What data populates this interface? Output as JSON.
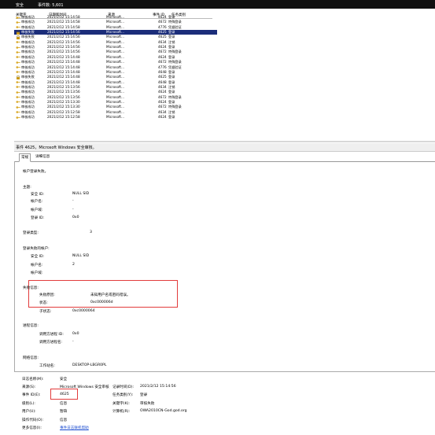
{
  "topbar": {
    "title": "安全",
    "count": "事件数: 5,601"
  },
  "columns": [
    "关键字",
    "日期和时间",
    "来源",
    "事件 ID",
    "任务类别"
  ],
  "events": [
    {
      "k": "审核成功",
      "d": "2021/2/12 15:14:58",
      "s": "Microsoft...",
      "id": "4624",
      "c": "登录",
      "lock": false,
      "sel": false
    },
    {
      "k": "审核成功",
      "d": "2021/2/12 15:14:58",
      "s": "Microsoft...",
      "id": "4672",
      "c": "特殊登录",
      "lock": false,
      "sel": false
    },
    {
      "k": "审核成功",
      "d": "2021/2/12 15:14:58",
      "s": "Microsoft...",
      "id": "4776",
      "c": "凭据验证",
      "lock": false,
      "sel": false
    },
    {
      "k": "审核失败",
      "d": "2021/2/12 15:14:56",
      "s": "Microsoft...",
      "id": "4625",
      "c": "登录",
      "lock": true,
      "sel": true
    },
    {
      "k": "审核失败",
      "d": "2021/2/12 15:14:56",
      "s": "Microsoft...",
      "id": "4625",
      "c": "登录",
      "lock": true,
      "sel": false
    },
    {
      "k": "审核成功",
      "d": "2021/2/12 15:14:56",
      "s": "Microsoft...",
      "id": "4634",
      "c": "注销",
      "lock": false,
      "sel": false
    },
    {
      "k": "审核成功",
      "d": "2021/2/12 15:14:56",
      "s": "Microsoft...",
      "id": "4624",
      "c": "登录",
      "lock": false,
      "sel": false
    },
    {
      "k": "审核成功",
      "d": "2021/2/12 15:14:56",
      "s": "Microsoft...",
      "id": "4672",
      "c": "特殊登录",
      "lock": false,
      "sel": false
    },
    {
      "k": "审核成功",
      "d": "2021/2/12 15:14:48",
      "s": "Microsoft...",
      "id": "4624",
      "c": "登录",
      "lock": false,
      "sel": false
    },
    {
      "k": "审核成功",
      "d": "2021/2/12 15:14:48",
      "s": "Microsoft...",
      "id": "4672",
      "c": "特殊登录",
      "lock": false,
      "sel": false
    },
    {
      "k": "审核成功",
      "d": "2021/2/12 15:14:48",
      "s": "Microsoft...",
      "id": "4776",
      "c": "凭据验证",
      "lock": false,
      "sel": false
    },
    {
      "k": "审核成功",
      "d": "2021/2/12 15:14:48",
      "s": "Microsoft...",
      "id": "4648",
      "c": "登录",
      "lock": false,
      "sel": false
    },
    {
      "k": "审核失败",
      "d": "2021/2/12 15:14:48",
      "s": "Microsoft...",
      "id": "4625",
      "c": "登录",
      "lock": true,
      "sel": false
    },
    {
      "k": "审核成功",
      "d": "2021/2/12 15:14:48",
      "s": "Microsoft...",
      "id": "4648",
      "c": "登录",
      "lock": false,
      "sel": false
    },
    {
      "k": "审核成功",
      "d": "2021/2/12 15:13:56",
      "s": "Microsoft...",
      "id": "4634",
      "c": "注销",
      "lock": false,
      "sel": false
    },
    {
      "k": "审核成功",
      "d": "2021/2/12 15:13:56",
      "s": "Microsoft...",
      "id": "4624",
      "c": "登录",
      "lock": false,
      "sel": false
    },
    {
      "k": "审核成功",
      "d": "2021/2/12 15:13:56",
      "s": "Microsoft...",
      "id": "4672",
      "c": "特殊登录",
      "lock": false,
      "sel": false
    },
    {
      "k": "审核成功",
      "d": "2021/2/12 15:13:30",
      "s": "Microsoft...",
      "id": "4624",
      "c": "登录",
      "lock": false,
      "sel": false
    },
    {
      "k": "审核成功",
      "d": "2021/2/12 15:13:30",
      "s": "Microsoft...",
      "id": "4672",
      "c": "特殊登录",
      "lock": false,
      "sel": false
    },
    {
      "k": "审核成功",
      "d": "2021/2/12 15:12:58",
      "s": "Microsoft...",
      "id": "4634",
      "c": "注销",
      "lock": false,
      "sel": false
    },
    {
      "k": "审核成功",
      "d": "2021/2/12 15:12:58",
      "s": "Microsoft...",
      "id": "4624",
      "c": "登录",
      "lock": false,
      "sel": false
    }
  ],
  "detail": {
    "title": "事件 4625，Microsoft Windows 安全审核。",
    "tabs": [
      "常规",
      "详细信息"
    ],
    "failed_msg": "帐户登录失败。",
    "subject": "主题:",
    "security_id_label": "安全 ID:",
    "security_id": "NULL SID",
    "account_name_label": "帐户名:",
    "account_name": "-",
    "account_domain_label": "帐户域:",
    "account_domain": "-",
    "logon_id_label": "登录 ID:",
    "logon_id": "0x0",
    "logon_type_label": "登录类型:",
    "logon_type": "3",
    "failed_acct": "登录失败的帐户:",
    "f_security_id": "NULL SID",
    "f_account_name": "2",
    "failure_info": "失败信息:",
    "reason_label": "失败原因:",
    "reason": "未知用户名或密码错误。",
    "status_label": "状态:",
    "status": "0xc000006d",
    "substatus_label": "子状态:",
    "substatus": "0xc0000064",
    "process_info": "进程信息:",
    "caller_pid_label": "调用方进程 ID:",
    "caller_pid": "0x0",
    "caller_name_label": "调用方进程名:",
    "caller_name": "-",
    "network_info": "网络信息:",
    "workstation_label": "工作站名:",
    "workstation": "DESKTOP-LBGR0PL"
  },
  "props": {
    "logname_label": "日志名称(M):",
    "logname": "安全",
    "source_label": "来源(S):",
    "source": "Microsoft Windows 安全审核",
    "logged_label": "记录时间(D):",
    "logged": "2021/2/12 15:14:56",
    "eventid_label": "事件 ID(E):",
    "eventid": "4625",
    "taskcat_label": "任务类别(Y):",
    "taskcat": "登录",
    "level_label": "级别(L):",
    "level": "信息",
    "keywords_label": "关键字(K):",
    "keywords": "审核失败",
    "user_label": "用户(U):",
    "user": "暂缺",
    "computer_label": "计算机(R):",
    "computer": "OWA2010CN-God.god.org",
    "opcode_label": "操作代码(O):",
    "opcode": "信息",
    "moreinfo_label": "更多信息(I):",
    "moreinfo": "事件日志联机帮助"
  }
}
